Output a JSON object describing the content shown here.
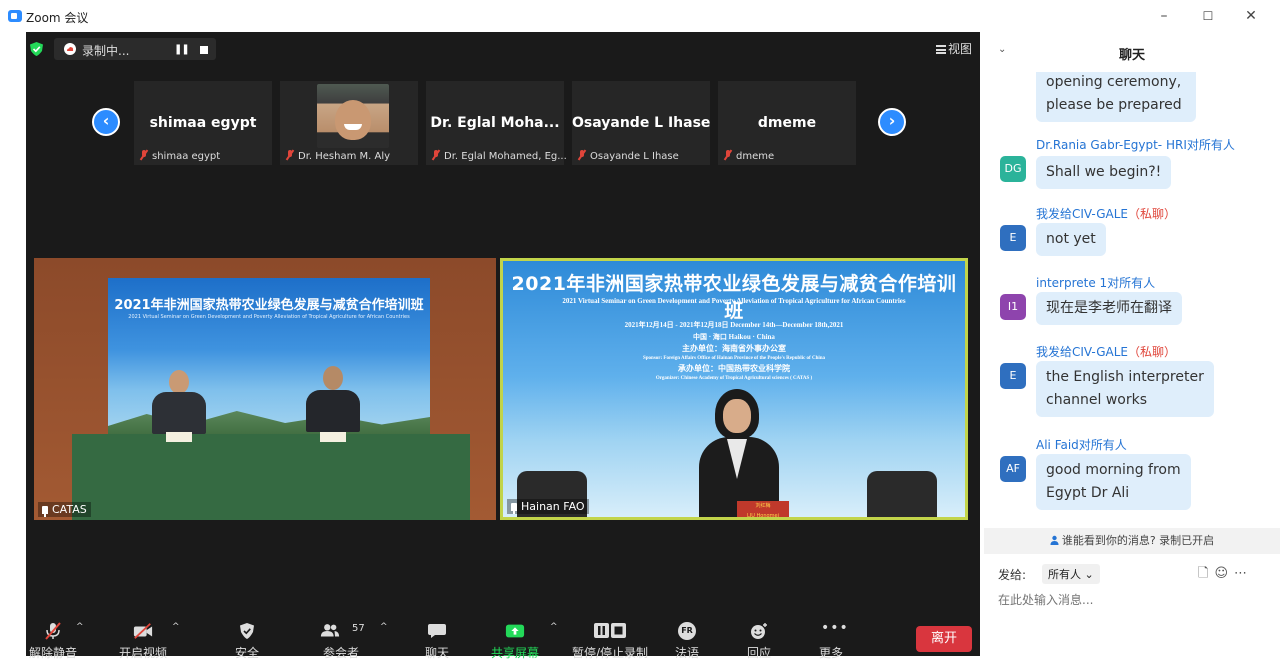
{
  "window": {
    "title": "Zoom 会议",
    "minimize": "–",
    "maximize": "☐",
    "close": "✕"
  },
  "topbar": {
    "recording_label": "录制中...",
    "view_label": "视图"
  },
  "gallery": {
    "tiles": [
      {
        "display": "shimaa egypt",
        "name": "shimaa egypt",
        "video": false
      },
      {
        "display": "",
        "name": "Dr. Hesham M. Aly",
        "video": true
      },
      {
        "display": "Dr. Eglal Moha...",
        "name": "Dr. Eglal Mohamed, Eg...",
        "video": false
      },
      {
        "display": "Osayande L Ihase",
        "name": "Osayande L Ihase",
        "video": false
      },
      {
        "display": "dmeme",
        "name": "dmeme",
        "video": false
      }
    ]
  },
  "feeds": {
    "left": {
      "label": "CATAS",
      "title_cn": "2021年非洲国家热带农业绿色发展与减贫合作培训班",
      "title_en": "2021 Virtual Seminar on Green Development and Poverty Alleviation of Tropical Agriculture for African Countries"
    },
    "right": {
      "label": "Hainan FAO",
      "title_cn": "2021年非洲国家热带农业绿色发展与减贫合作培训班",
      "title_en": "2021 Virtual Seminar on Green Development and Poverty Alleviation of Tropical Agriculture for African Countries",
      "dates": "2021年12月14日 - 2021年12月18日    December 14th—December 18th,2021",
      "place": "中国 · 海口    Haikou · China",
      "sponsor_cn": "主办单位：海南省外事办公室",
      "sponsor_en": "Sponsor: Foreign Affairs Office of Hainan Province of the People's Republic of China",
      "organizer_cn": "承办单位：中国热带农业科学院",
      "organizer_en": "Organizer: Chinese Academy of Tropical Agricultural sciences ( CATAS )",
      "nameplate_cn": "刘红梅",
      "nameplate_en": "LIU Hongmei"
    }
  },
  "toolbar": {
    "items": [
      {
        "label": "解除静音",
        "icon": "mic-off-icon"
      },
      {
        "label": "开启视频",
        "icon": "video-off-icon"
      },
      {
        "label": "安全",
        "icon": "shield-icon"
      },
      {
        "label": "参会者",
        "icon": "participants-icon",
        "count": "57"
      },
      {
        "label": "聊天",
        "icon": "chat-icon"
      },
      {
        "label": "共享屏幕",
        "icon": "share-screen-icon"
      },
      {
        "label": "暂停/停止录制",
        "icon": "pause-stop-record-icon"
      },
      {
        "label": "法语",
        "icon": "language-icon",
        "badge": "FR"
      },
      {
        "label": "回应",
        "icon": "reaction-icon"
      },
      {
        "label": "更多",
        "icon": "more-icon"
      }
    ],
    "leave_label": "离开",
    "colors": {
      "share_green": "#23d959",
      "leave_red": "#d9363e"
    }
  },
  "chat": {
    "title": "聊天",
    "messages": [
      {
        "sender": "",
        "to": "",
        "private": "",
        "avatar": "",
        "text_lines": [
          "opening ceremony,",
          "please be prepared"
        ]
      },
      {
        "sender": "Dr.Rania Gabr-Egypt- HRI",
        "to": "对所有人",
        "private": "",
        "avatar": "DG",
        "avatar_color": "#2bb39a",
        "text_lines": [
          "Shall we begin?!"
        ]
      },
      {
        "sender": "我发给CIV-GALE",
        "to": "",
        "private": "（私聊）",
        "avatar": "E",
        "avatar_color": "#2f6fbf",
        "text_lines": [
          "not yet"
        ]
      },
      {
        "sender": "interprete 1",
        "to": "对所有人",
        "private": "",
        "avatar": "I1",
        "avatar_color": "#8e44ad",
        "text_lines": [
          "现在是李老师在翻译"
        ]
      },
      {
        "sender": "我发给CIV-GALE",
        "to": "",
        "private": "（私聊）",
        "avatar": "E",
        "avatar_color": "#2f6fbf",
        "text_lines": [
          "the English interpreter",
          "channel works"
        ]
      },
      {
        "sender": "Ali Faid",
        "to": "对所有人",
        "private": "",
        "avatar": "AF",
        "avatar_color": "#2f6fbf",
        "text_lines": [
          "good morning from",
          "Egypt Dr Ali"
        ]
      }
    ],
    "notice": "谁能看到你的消息? 录制已开启",
    "send_to_label": "发给:",
    "send_target": "所有人",
    "input_placeholder": "在此处输入消息..."
  }
}
